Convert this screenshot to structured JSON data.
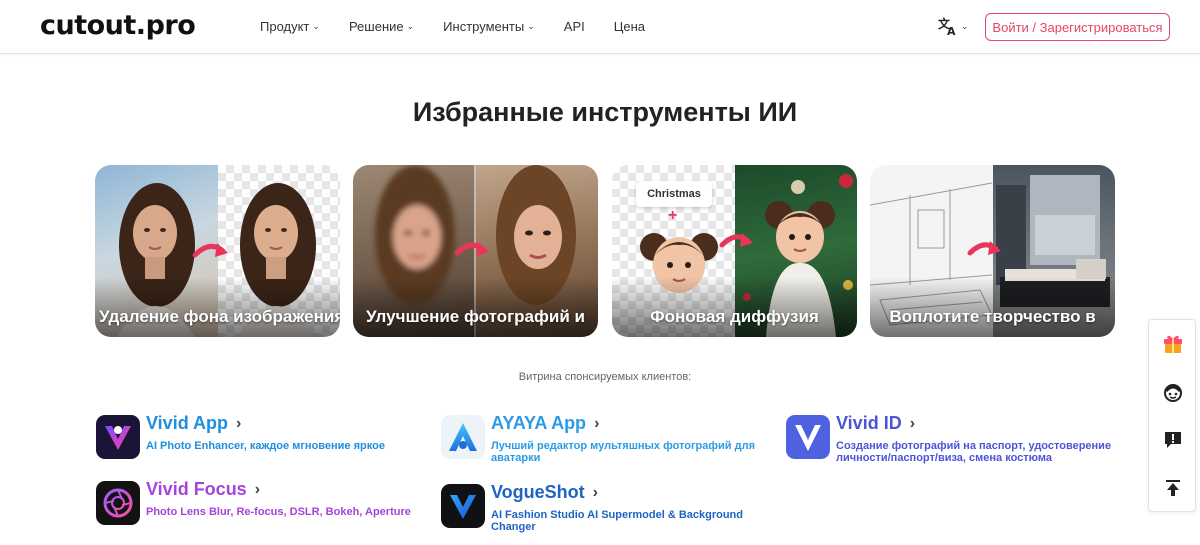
{
  "header": {
    "logo": "cutout.pro",
    "nav": [
      {
        "label": "Продукт",
        "has_dropdown": true
      },
      {
        "label": "Решение",
        "has_dropdown": true
      },
      {
        "label": "Инструменты",
        "has_dropdown": true
      },
      {
        "label": "API",
        "has_dropdown": false
      },
      {
        "label": "Цена",
        "has_dropdown": false
      }
    ],
    "language_icon": "translate-icon",
    "login_label": "Войти / Зарегистрироваться"
  },
  "featured": {
    "title": "Избранные инструменты ИИ",
    "cards": [
      {
        "label": "Удаление фона изображения"
      },
      {
        "label": "Улучшение фотографий и"
      },
      {
        "label": "Фоновая диффузия",
        "tag": "Christmas",
        "plus": "+"
      },
      {
        "label": "Воплотите творчество в"
      }
    ]
  },
  "sponsored": {
    "title": "Витрина спонсируемых клиентов:",
    "apps": [
      {
        "name": "Vivid App",
        "desc": "AI Photo Enhancer, каждое мгновение яркое",
        "color": "#1f8de0",
        "icon": "vivid-app-icon"
      },
      {
        "name": "AYAYA App",
        "desc": "Лучший редактор мультяшных фотографий для аватарки",
        "color": "#2c9be6",
        "icon": "ayaya-app-icon"
      },
      {
        "name": "Vivid ID",
        "desc": "Создание фотографий на паспорт, удостоверение личности/паспорт/виза, смена костюма",
        "color": "#4b55d6",
        "icon": "vivid-id-icon"
      },
      {
        "name": "Vivid Focus",
        "desc": "Photo Lens Blur, Re-focus, DSLR, Bokeh, Aperture",
        "color": "#a743d8",
        "icon": "vivid-focus-icon"
      },
      {
        "name": "VogueShot",
        "desc": "AI Fashion Studio AI Supermodel & Background Changer",
        "color": "#1e63c4",
        "icon": "vogueshot-icon"
      }
    ]
  },
  "sidebar": {
    "buttons": [
      "gift-icon",
      "support-face-icon",
      "feedback-icon",
      "back-to-top-icon"
    ]
  },
  "colors": {
    "accent": "#e8456a",
    "arrow": "#e8355a"
  }
}
